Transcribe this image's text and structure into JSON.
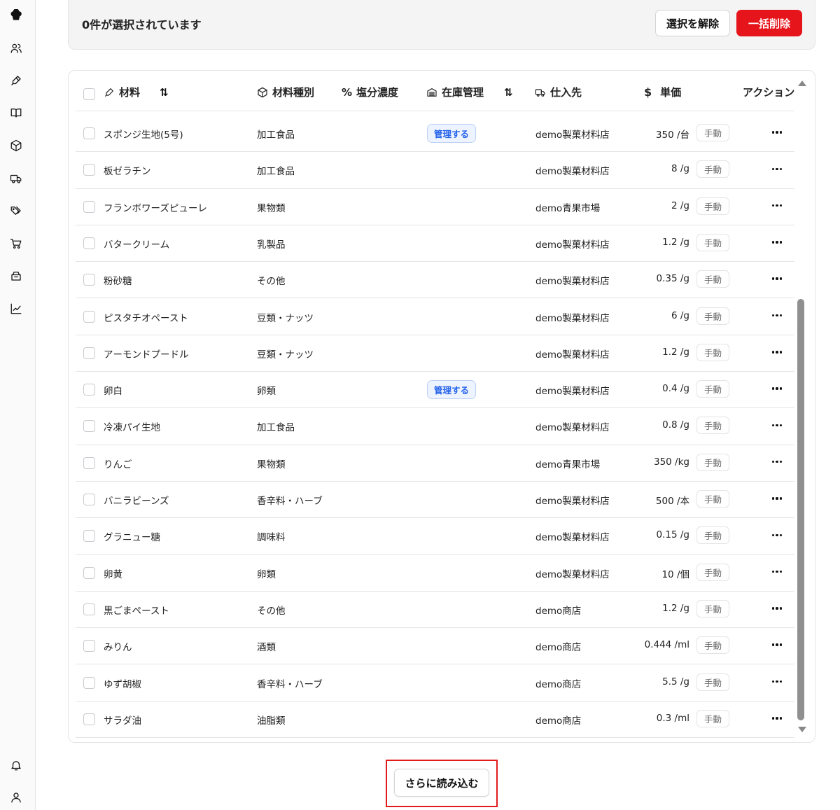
{
  "sidebar": {
    "icons": [
      "chef-hat-icon",
      "users-icon",
      "pen-tool-icon",
      "book-icon",
      "package-icon",
      "truck-icon",
      "tags-icon",
      "cart-icon",
      "inventory-icon",
      "chart-icon",
      "bell-icon",
      "user-icon"
    ]
  },
  "selection": {
    "count_text": "0件が選択されています",
    "clear_label": "選択を解除",
    "delete_label": "一括削除"
  },
  "table": {
    "headers": {
      "material": "材料",
      "type": "材料種別",
      "salt": "塩分濃度",
      "stock": "在庫管理",
      "supplier": "仕入先",
      "price": "単価",
      "action": "アクション"
    },
    "rows": [
      {
        "name": "スポンジ生地(5号)",
        "type": "加工食品",
        "stock": "管理する",
        "supplier": "demo製菓材料店",
        "price": "350 /台",
        "mode": "手動"
      },
      {
        "name": "板ゼラチン",
        "type": "加工食品",
        "stock": "",
        "supplier": "demo製菓材料店",
        "price": "8 /g",
        "mode": "手動"
      },
      {
        "name": "フランボワーズピューレ",
        "type": "果物類",
        "stock": "",
        "supplier": "demo青果市場",
        "price": "2 /g",
        "mode": "手動"
      },
      {
        "name": "バタークリーム",
        "type": "乳製品",
        "stock": "",
        "supplier": "demo製菓材料店",
        "price": "1.2 /g",
        "mode": "手動"
      },
      {
        "name": "粉砂糖",
        "type": "その他",
        "stock": "",
        "supplier": "demo製菓材料店",
        "price": "0.35 /g",
        "mode": "手動"
      },
      {
        "name": "ピスタチオペースト",
        "type": "豆類・ナッツ",
        "stock": "",
        "supplier": "demo製菓材料店",
        "price": "6 /g",
        "mode": "手動"
      },
      {
        "name": "アーモンドプードル",
        "type": "豆類・ナッツ",
        "stock": "",
        "supplier": "demo製菓材料店",
        "price": "1.2 /g",
        "mode": "手動"
      },
      {
        "name": "卵白",
        "type": "卵類",
        "stock": "管理する",
        "supplier": "demo製菓材料店",
        "price": "0.4 /g",
        "mode": "手動"
      },
      {
        "name": "冷凍パイ生地",
        "type": "加工食品",
        "stock": "",
        "supplier": "demo製菓材料店",
        "price": "0.8 /g",
        "mode": "手動"
      },
      {
        "name": "りんご",
        "type": "果物類",
        "stock": "",
        "supplier": "demo青果市場",
        "price": "350 /kg",
        "mode": "手動"
      },
      {
        "name": "バニラビーンズ",
        "type": "香辛料・ハーブ",
        "stock": "",
        "supplier": "demo製菓材料店",
        "price": "500 /本",
        "mode": "手動"
      },
      {
        "name": "グラニュー糖",
        "type": "調味料",
        "stock": "",
        "supplier": "demo製菓材料店",
        "price": "0.15 /g",
        "mode": "手動"
      },
      {
        "name": "卵黄",
        "type": "卵類",
        "stock": "",
        "supplier": "demo製菓材料店",
        "price": "10 /個",
        "mode": "手動"
      },
      {
        "name": "黒ごまペースト",
        "type": "その他",
        "stock": "",
        "supplier": "demo商店",
        "price": "1.2 /g",
        "mode": "手動"
      },
      {
        "name": "みりん",
        "type": "酒類",
        "stock": "",
        "supplier": "demo商店",
        "price": "0.444 /ml",
        "mode": "手動"
      },
      {
        "name": "ゆず胡椒",
        "type": "香辛料・ハーブ",
        "stock": "",
        "supplier": "demo商店",
        "price": "5.5 /g",
        "mode": "手動"
      },
      {
        "name": "サラダ油",
        "type": "油脂類",
        "stock": "",
        "supplier": "demo商店",
        "price": "0.3 /ml",
        "mode": "手動"
      }
    ]
  },
  "load_more": {
    "label": "さらに読み込む"
  }
}
